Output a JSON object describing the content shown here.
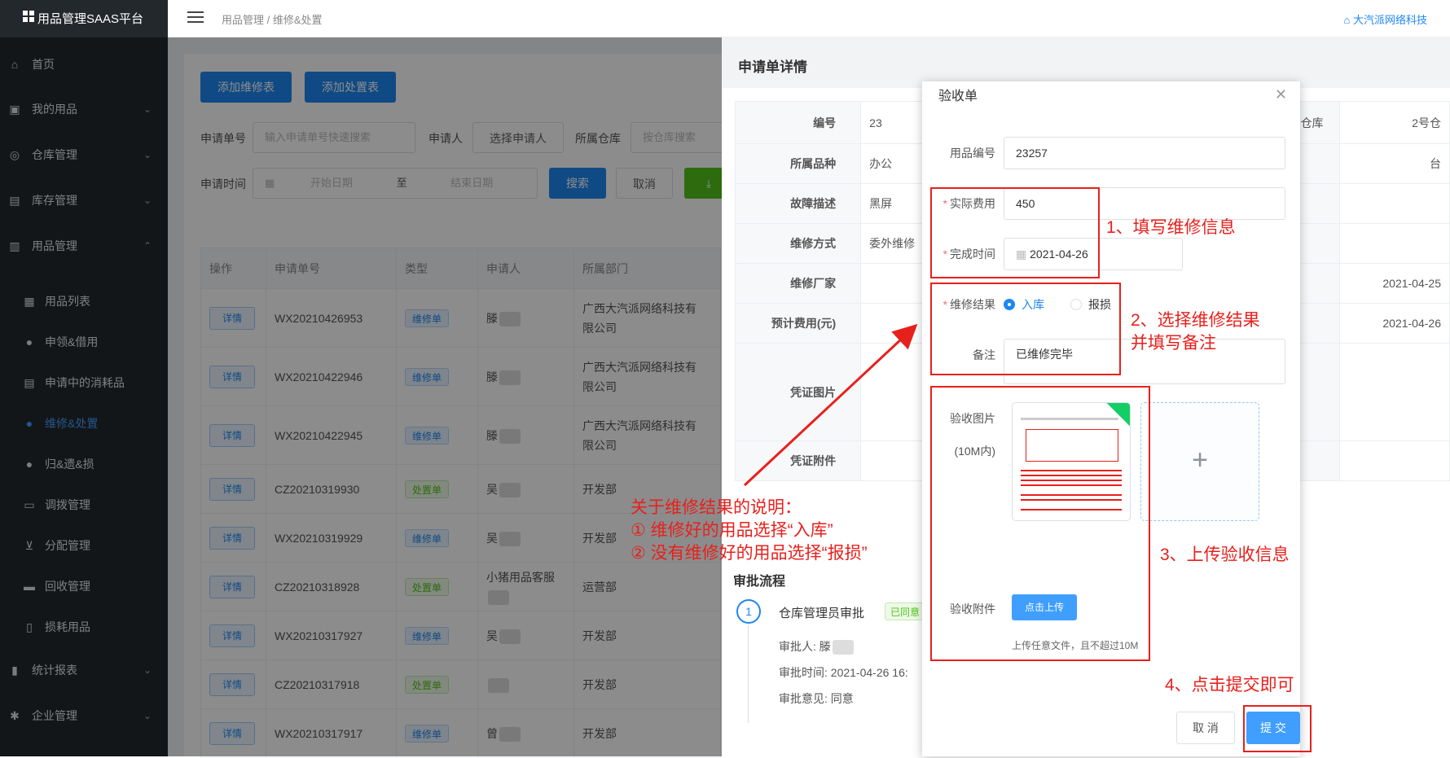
{
  "app": {
    "title": "用品管理SAAS平台",
    "company": "大汽派网络科技"
  },
  "breadcrumb": {
    "text": "用品管理 / 维修&处置"
  },
  "sidebar": {
    "items": [
      {
        "label": "首页",
        "icon": "home-icon"
      },
      {
        "label": "我的用品",
        "icon": "bag-icon"
      },
      {
        "label": "仓库管理",
        "icon": "database-icon"
      },
      {
        "label": "库存管理",
        "icon": "box-icon"
      },
      {
        "label": "用品管理",
        "icon": "briefcase-icon"
      },
      {
        "label": "用品列表",
        "icon": "list-icon"
      },
      {
        "label": "申领&借用",
        "icon": "user-icon"
      },
      {
        "label": "申请中的消耗品",
        "icon": "doc-icon"
      },
      {
        "label": "维修&处置",
        "icon": "user-icon"
      },
      {
        "label": "归&遗&损",
        "icon": "user-icon"
      },
      {
        "label": "调拨管理",
        "icon": "truck-icon"
      },
      {
        "label": "分配管理",
        "icon": "cart-icon"
      },
      {
        "label": "回收管理",
        "icon": "monitor-icon"
      },
      {
        "label": "损耗用品",
        "icon": "trash-icon"
      },
      {
        "label": "统计报表",
        "icon": "chart-icon"
      },
      {
        "label": "企业管理",
        "icon": "gear-icon"
      }
    ]
  },
  "toolbar": {
    "add_repair": "添加维修表",
    "add_dispose": "添加处置表"
  },
  "filters": {
    "order_no_label": "申请单号",
    "order_no_placeholder": "输入申请单号快速搜索",
    "applicant_label": "申请人",
    "applicant_btn": "选择申请人",
    "warehouse_label": "所属仓库",
    "warehouse_placeholder": "按仓库搜索",
    "time_label": "申请时间",
    "start_placeholder": "开始日期",
    "to": "至",
    "end_placeholder": "结束日期",
    "search": "搜索",
    "cancel": "取消"
  },
  "table": {
    "headers": [
      "操作",
      "申请单号",
      "类型",
      "申请人",
      "所属部门"
    ],
    "detail_label": "详情",
    "rows": [
      {
        "no": "WX20210426953",
        "type": "维修单",
        "applicant": "滕",
        "dept": "广西大汽派网络科技有限公司"
      },
      {
        "no": "WX20210422946",
        "type": "维修单",
        "applicant": "滕",
        "dept": "广西大汽派网络科技有限公司"
      },
      {
        "no": "WX20210422945",
        "type": "维修单",
        "applicant": "滕",
        "dept": "广西大汽派网络科技有限公司"
      },
      {
        "no": "CZ20210319930",
        "type": "处置单",
        "applicant": "吴",
        "dept": "开发部"
      },
      {
        "no": "WX20210319929",
        "type": "维修单",
        "applicant": "吴",
        "dept": "开发部"
      },
      {
        "no": "CZ20210318928",
        "type": "处置单",
        "applicant": "小猪用品客服",
        "dept": "运营部"
      },
      {
        "no": "WX20210317927",
        "type": "维修单",
        "applicant": "吴",
        "dept": "开发部"
      },
      {
        "no": "CZ20210317918",
        "type": "处置单",
        "applicant": "",
        "dept": "开发部"
      },
      {
        "no": "WX20210317917",
        "type": "维修单",
        "applicant": "曾",
        "dept": "开发部"
      }
    ]
  },
  "drawer": {
    "title": "申请单详情",
    "rows": [
      {
        "k": "编号",
        "v": "23",
        "k2": "仓库",
        "v2": "2号仓"
      },
      {
        "k": "所属品种",
        "v": "办公",
        "k2": "",
        "v2": "台"
      },
      {
        "k": "故障描述",
        "v": "黑屏",
        "k2": "",
        "v2": ""
      },
      {
        "k": "维修方式",
        "v": "委外维修",
        "k2": "",
        "v2": ""
      },
      {
        "k": "维修厂家",
        "v": "",
        "k2": "",
        "v2": "2021-04-25"
      },
      {
        "k": "预计费用(元)",
        "v": "",
        "k2": "",
        "v2": "2021-04-26"
      },
      {
        "k": "凭证图片",
        "v": "",
        "k2": "",
        "v2": ""
      },
      {
        "k": "凭证附件",
        "v": "",
        "k2": "",
        "v2": ""
      }
    ],
    "approval_title": "审批流程",
    "step_no": "1",
    "step_name": "仓库管理员审批",
    "step_status": "已同意",
    "approver": "审批人: 滕",
    "approve_time": "审批时间: 2021-04-26 16:",
    "approve_opinion": "审批意见: 同意"
  },
  "modal": {
    "title": "验收单",
    "item_no_label": "用品编号",
    "item_no": "23257",
    "cost_label": "实际费用",
    "cost": "450",
    "done_label": "完成时间",
    "done": "2021-04-26",
    "result_label": "维修结果",
    "result_in": "入库",
    "result_scrap": "报损",
    "note_label": "备注",
    "note": "已维修完毕",
    "img_label": "验收图片",
    "img_limit": "(10M内)",
    "attach_label": "验收附件",
    "upload_btn": "点击上传",
    "upload_tip": "上传任意文件，且不超过10M",
    "cancel": "取 消",
    "submit": "提 交"
  },
  "annotations": {
    "a1": "1、填写维修信息",
    "a2_line1": "2、选择维修结果",
    "a2_line2": "并填写备注",
    "a3": "3、上传验收信息",
    "a4": "4、点击提交即可",
    "note_line1": "关于维修结果的说明：",
    "note_line2": "① 维修好的用品选择“入库”",
    "note_line3": "② 没有维修好的用品选择“报损”"
  },
  "colors": {
    "accent": "#1e87f0",
    "sidebar": "#23282d",
    "annotation": "#e8201c",
    "success": "#52c41a"
  }
}
